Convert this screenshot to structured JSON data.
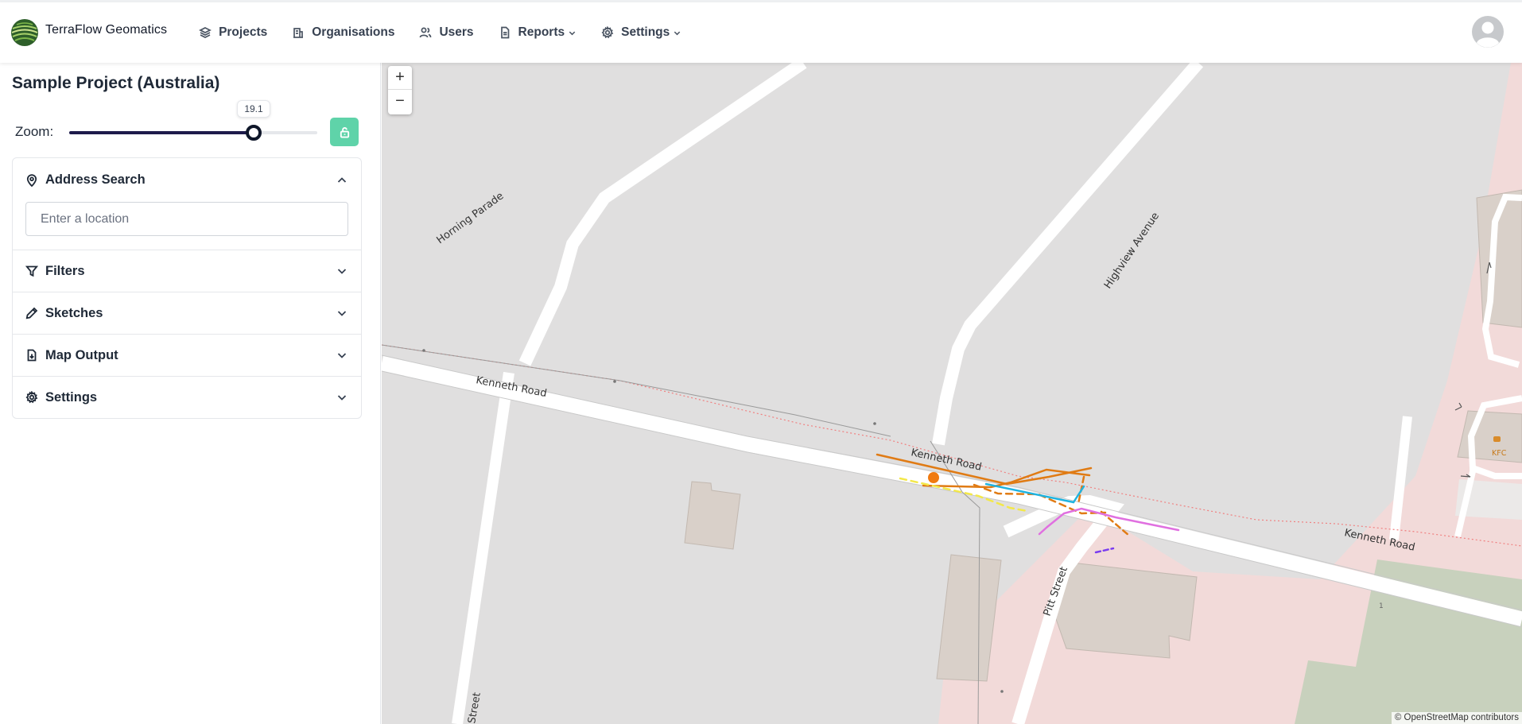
{
  "header": {
    "brand_name": "TerraFlow Geomatics",
    "nav": [
      {
        "label": "Projects",
        "icon": "layers-icon"
      },
      {
        "label": "Organisations",
        "icon": "building-icon"
      },
      {
        "label": "Users",
        "icon": "users-icon"
      },
      {
        "label": "Reports",
        "icon": "document-icon",
        "dropdown": true
      },
      {
        "label": "Settings",
        "icon": "gear-icon",
        "dropdown": true
      }
    ]
  },
  "sidebar": {
    "project_title": "Sample Project (Australia)",
    "zoom": {
      "label": "Zoom:",
      "value": "19.1",
      "fraction": 0.745,
      "lock_state": "unlocked"
    },
    "sections": [
      {
        "title": "Address Search",
        "icon": "map-pin-icon",
        "expanded": true,
        "placeholder": "Enter a location",
        "value": ""
      },
      {
        "title": "Filters",
        "icon": "filter-icon",
        "expanded": false
      },
      {
        "title": "Sketches",
        "icon": "pencil-icon",
        "expanded": false
      },
      {
        "title": "Map Output",
        "icon": "file-download-icon",
        "expanded": false
      },
      {
        "title": "Settings",
        "icon": "gear-icon",
        "expanded": false
      }
    ]
  },
  "map": {
    "zoom_in": "+",
    "zoom_out": "−",
    "attribution": "© OpenStreetMap contributors",
    "labels": {
      "horning": "Horning Parade",
      "highview": "Highview Avenue",
      "kenneth1": "Kenneth Road",
      "kenneth2": "Kenneth Road",
      "kenneth3": "Kenneth Road",
      "pitt": "Pitt Street",
      "street_left": "Street",
      "kfc": "KFC",
      "bldg_num": "1"
    },
    "colors": {
      "background": "#e0dfdf",
      "road": "#ffffff",
      "commercial": "#f2dad9",
      "building": "#d9d0c9",
      "park": "#c8d1bd",
      "orange_utility": "#e07b14",
      "cyan_utility": "#1fb3e0",
      "yellow_utility": "#f3e84a",
      "magenta_utility": "#e070e0",
      "purple_utility": "#7a3cf0",
      "rail": "#f08080"
    }
  }
}
